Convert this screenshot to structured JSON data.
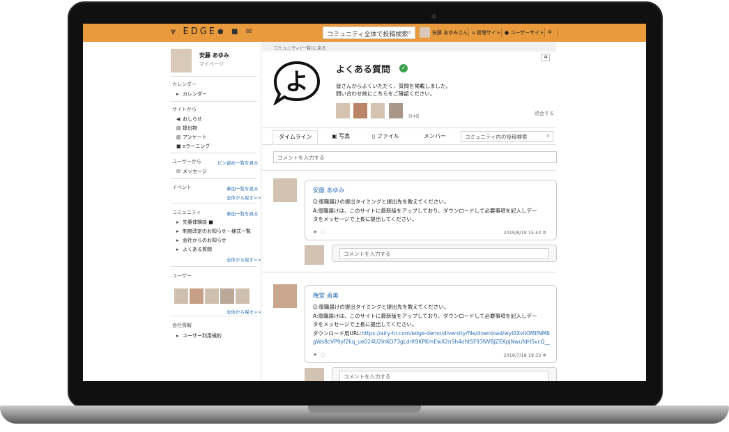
{
  "topbar": {
    "logo": "EDGE",
    "search_placeholder": "コミュニティ全体で投稿検索",
    "user_name": "安藤 あゆみさん",
    "admin_site": "管理サイト",
    "user_site": "ユーザーサイト"
  },
  "sidebar": {
    "profile": {
      "name": "安藤 あゆみ",
      "sub": "マイページ"
    },
    "calendar": {
      "heading": "カレンダー",
      "item": "カレンダー"
    },
    "from_site": {
      "heading": "サイトから",
      "items": [
        "おしらせ",
        "提出物",
        "アンケート",
        "eラーニング"
      ]
    },
    "from_users": {
      "heading": "ユーザーから",
      "link": "ピン留め一覧を見る",
      "item": "メッセージ"
    },
    "events": {
      "heading": "イベント",
      "link": "参加一覧を見る",
      "link2": "全体から探す>>"
    },
    "community": {
      "heading": "コミュニティ",
      "link": "参加一覧を見る",
      "items": [
        "先輩体験談",
        "制度改定のお知らせ・様式一覧",
        "会社からのお知らせ",
        "よくある質問"
      ],
      "link2": "全体から探す>>"
    },
    "users": {
      "heading": "ユーザー",
      "link": "全体から探す>>"
    },
    "company": {
      "heading": "会社情報",
      "item": "ユーザー利用規約"
    }
  },
  "main": {
    "breadcrumb": "コミュニティ(一覧)に戻る",
    "community_icon_char": "よ",
    "title": "よくある質問",
    "description_line1": "皆さんからよくいただく、質問を掲載しました。",
    "description_line2": "問い合わせ前にこちらをご確認ください。",
    "member_count": "計4名",
    "leave": "退会する",
    "tabs": [
      "タイムライン",
      "写真",
      "ファイル",
      "メンバー"
    ],
    "tab_search_placeholder": "コミュニティ内の投稿検索",
    "comment_placeholder": "コメントを入力する",
    "posts": [
      {
        "author": "安藤 あゆみ",
        "q": "Q:復職届けの提出タイミングと提出先を教えてください。",
        "a1": "A:復職届けは、このサイトに最新版をアップしており、ダウンロードして必要事項を記入しデー",
        "a2": "タをメッセージで上長に提出してください。",
        "date": "2019/8/19 15:42",
        "reply_placeholder": "コメントを入力する"
      },
      {
        "author": "権堂 直美",
        "q": "Q:復職届けの提出タイミングと提出先を教えてください。",
        "a1": "A:復職届けは、このサイトに最新版をアップしており、ダウンロードして必要事項を記入しデー",
        "a2": "タをメッセージで上長に提出してください。",
        "url_label": "ダウンロード用URL:",
        "url": "https://airy-hr.com/edge-demo/diversity/file/download/wyl0XvlIOMIfNM6gWs8cVP9yf2kq_ue024U2InKO73gLdrK9KPKmEwX2nSh4ohtSF93NVBJZEKpJNwufdHSvcQ__",
        "date": "2018/7/18 19:32",
        "reply_placeholder": "コメントを入力する"
      }
    ]
  },
  "colors": {
    "accent": "#e89a3c",
    "link": "#2a6fb5",
    "check": "#3aa14a"
  }
}
